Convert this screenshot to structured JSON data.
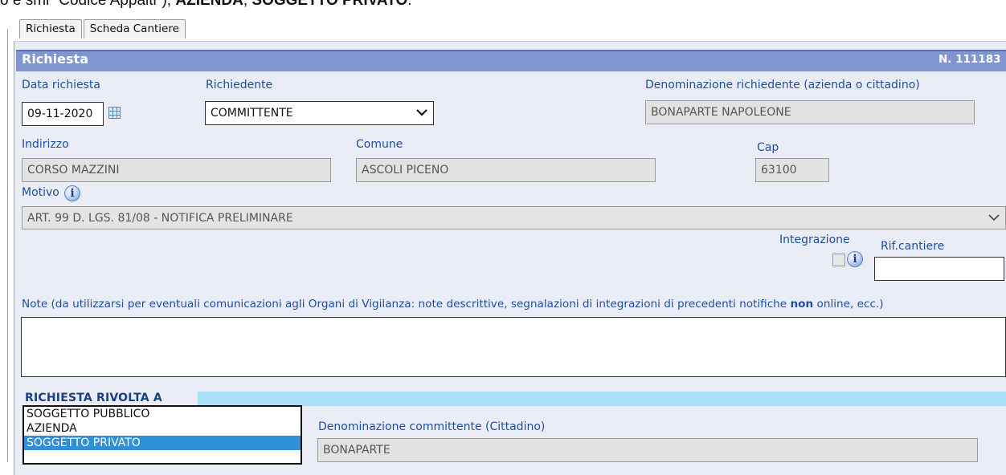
{
  "top_text": {
    "prefix": "o e smi \"Codice Appalti\"), ",
    "bold1": "AZIENDA",
    "sep": ", ",
    "bold2": "SOGGETTO PRIVATO",
    "suffix": "."
  },
  "tabs": [
    "Richiesta",
    "Scheda Cantiere"
  ],
  "header": {
    "title": "Richiesta",
    "number": "N. 111183"
  },
  "fields": {
    "data_richiesta": {
      "label": "Data richiesta",
      "value": "09-11-2020"
    },
    "richiedente": {
      "label": "Richiedente",
      "value": "COMMITTENTE"
    },
    "denominazione_richiedente": {
      "label": "Denominazione richiedente (azienda o cittadino)",
      "value": "BONAPARTE NAPOLEONE"
    },
    "indirizzo": {
      "label": "Indirizzo",
      "value": "CORSO MAZZINI"
    },
    "comune": {
      "label": "Comune",
      "value": "ASCOLI PICENO"
    },
    "cap": {
      "label": "Cap",
      "value": "63100"
    },
    "motivo": {
      "label": "Motivo",
      "value": "ART. 99 D. LGS. 81/08 - NOTIFICA PRELIMINARE"
    },
    "integrazione": {
      "label": "Integrazione"
    },
    "rif_cantiere": {
      "label": "Rif.cantiere",
      "value": ""
    },
    "note": {
      "label_before": "Note (da utilizzarsi per eventuali comunicazioni agli Organi di Vigilanza: note descrittive, segnalazioni di integrazioni di precedenti notifiche ",
      "label_bold": "non",
      "label_after": " online, ecc.)",
      "value": ""
    }
  },
  "section": {
    "title": "RICHIESTA RIVOLTA A"
  },
  "rivolta_options": [
    "SOGGETTO PUBBLICO",
    "AZIENDA",
    "SOGGETTO PRIVATO"
  ],
  "rivolta_selected": "SOGGETTO PRIVATO",
  "committente": {
    "label": "Denominazione committente (Cittadino)",
    "value": "BONAPARTE"
  },
  "icons": {
    "calendar": "calendar-icon",
    "info": "info-icon",
    "dropdown": "chevron-down-icon"
  },
  "colors": {
    "header": "#7f96d0",
    "label": "#1f4fa3",
    "section_bar": "#a9e1f8",
    "selected_option": "#2f8fd9"
  }
}
